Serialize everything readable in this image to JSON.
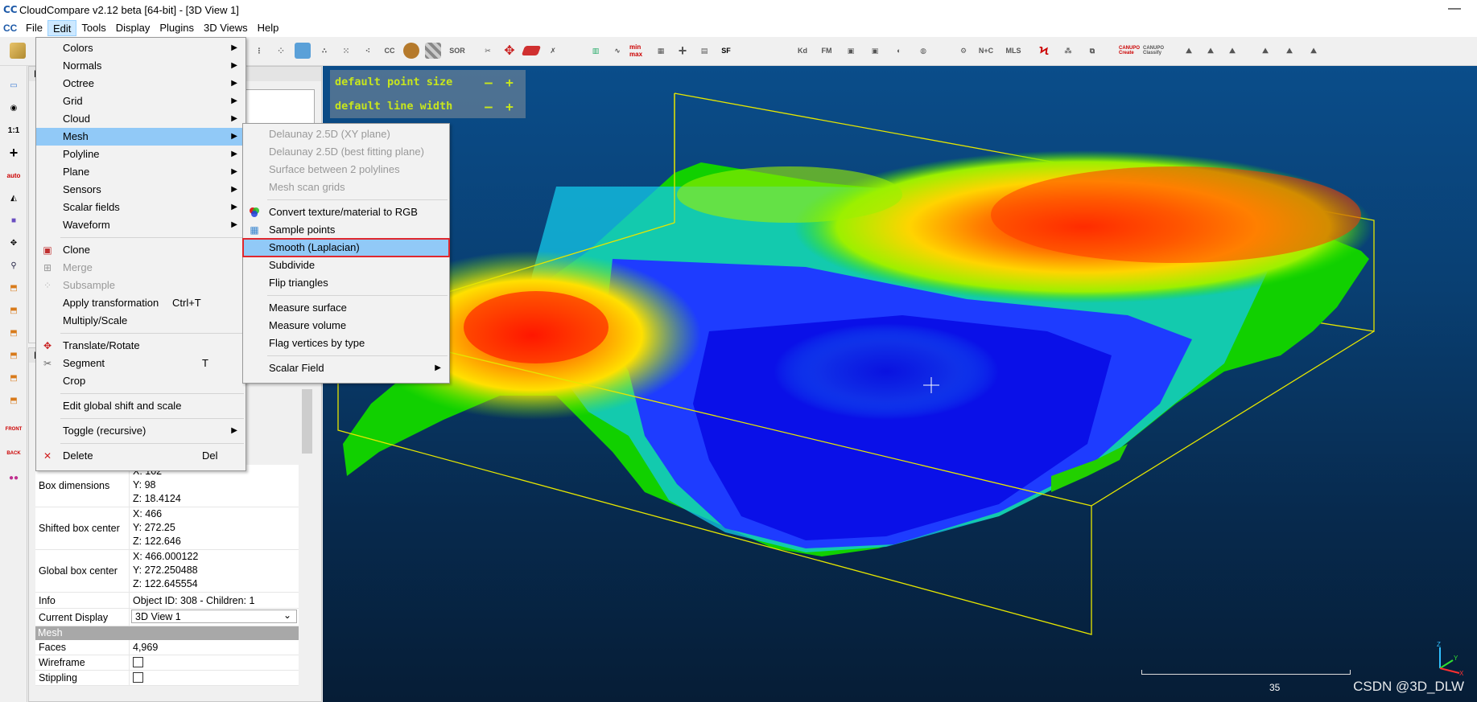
{
  "window": {
    "title": "CloudCompare v2.12 beta [64-bit] - [3D View 1]",
    "minimize": "—"
  },
  "app_icon": "CC",
  "menubar": {
    "items": [
      "File",
      "Edit",
      "Tools",
      "Display",
      "Plugins",
      "3D Views",
      "Help"
    ],
    "active": "Edit"
  },
  "toolbar": {
    "labels": [
      "CC",
      "SOR",
      "min max",
      "SF",
      "Kd",
      "FM",
      "N+C",
      "MLS",
      "CANUPO Create",
      "CANUPO Classify"
    ]
  },
  "left_toolbar": {
    "labels": [
      "1:1",
      "auto",
      "FRONT",
      "BACK"
    ]
  },
  "db_panel": {
    "title": "DB"
  },
  "props_panel": {
    "title": "Pr"
  },
  "edit_menu": {
    "items": [
      {
        "label": "Colors",
        "submenu": true
      },
      {
        "label": "Normals",
        "submenu": true
      },
      {
        "label": "Octree",
        "submenu": true
      },
      {
        "label": "Grid",
        "submenu": true
      },
      {
        "label": "Cloud",
        "submenu": true
      },
      {
        "label": "Mesh",
        "submenu": true,
        "highlighted": true
      },
      {
        "label": "Polyline",
        "submenu": true
      },
      {
        "label": "Plane",
        "submenu": true
      },
      {
        "label": "Sensors",
        "submenu": true
      },
      {
        "label": "Scalar fields",
        "submenu": true
      },
      {
        "label": "Waveform",
        "submenu": true
      }
    ],
    "items2": [
      {
        "label": "Clone",
        "icon": "clone-icon"
      },
      {
        "label": "Merge",
        "icon": "merge-icon",
        "disabled": true
      },
      {
        "label": "Subsample",
        "icon": "subsample-icon",
        "disabled": true
      },
      {
        "label": "Apply transformation",
        "shortcut": "Ctrl+T"
      },
      {
        "label": "Multiply/Scale"
      }
    ],
    "items3": [
      {
        "label": "Translate/Rotate",
        "icon": "translate-rotate-icon"
      },
      {
        "label": "Segment",
        "icon": "segment-icon",
        "shortcut": "T"
      },
      {
        "label": "Crop"
      }
    ],
    "items4": [
      {
        "label": "Edit global shift and scale"
      }
    ],
    "items5": [
      {
        "label": "Toggle (recursive)",
        "submenu": true
      }
    ],
    "items6": [
      {
        "label": "Delete",
        "icon": "delete-icon",
        "shortcut": "Del"
      }
    ]
  },
  "mesh_submenu": {
    "group1": [
      "Delaunay 2.5D (XY plane)",
      "Delaunay 2.5D (best fitting plane)",
      "Surface between 2 polylines",
      "Mesh scan grids"
    ],
    "group2": [
      "Convert texture/material to RGB",
      "Sample points",
      "Smooth (Laplacian)",
      "Subdivide",
      "Flip triangles"
    ],
    "group3": [
      "Measure surface",
      "Measure volume",
      "Flag vertices by type"
    ],
    "group4": [
      "Scalar Field"
    ]
  },
  "properties": {
    "box_dimensions": {
      "label": "Box dimensions",
      "x": "X: 102",
      "y": "Y: 98",
      "z": "Z: 18.4124"
    },
    "shifted_box_center": {
      "label": "Shifted box center",
      "x": "X: 466",
      "y": "Y: 272.25",
      "z": "Z: 122.646"
    },
    "global_box_center": {
      "label": "Global box center",
      "x": "X: 466.000122",
      "y": "Y: 272.250488",
      "z": "Z: 122.645554"
    },
    "info": {
      "label": "Info",
      "value": "Object ID: 308 - Children: 1"
    },
    "current_display": {
      "label": "Current Display",
      "value": "3D View 1"
    },
    "mesh_section": "Mesh",
    "faces": {
      "label": "Faces",
      "value": "4,969"
    },
    "wireframe": {
      "label": "Wireframe",
      "checked": false
    },
    "stippling": {
      "label": "Stippling",
      "checked": false
    }
  },
  "view3d": {
    "overlay": {
      "point_size": "default point size",
      "line_width": "default line width",
      "minus": "—",
      "plus": "+"
    },
    "scale_value": "35",
    "axes": {
      "z": "Z",
      "y": "Y",
      "x": "X"
    },
    "watermark": "CSDN @3D_DLW"
  },
  "colors": {
    "accent_highlight": "#91c9f7",
    "selection_outline": "#e0282e",
    "overlay_text": "#c8e61c"
  }
}
